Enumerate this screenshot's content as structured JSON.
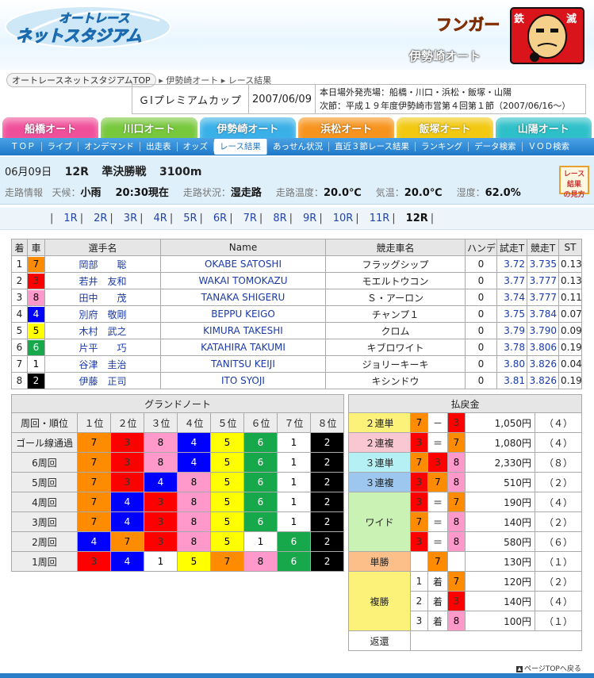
{
  "header": {
    "logo_line1": "オートレース",
    "logo_line2": "ネットスタジアム",
    "mascot_text": "フンガー",
    "mascot_badge": "鉄",
    "mascot_badge2": "滅",
    "site_sub": "伊勢崎オート"
  },
  "breadcrumb": {
    "home": "オートレースネットスタジアムTOP",
    "venue": "伊勢崎オート",
    "page": "レース結果"
  },
  "race_info": {
    "title": "ＧⅠプレミアムカップ",
    "date": "2007/06/09",
    "sales": "本日場外発売場：船橋・川口・浜松・飯塚・山陽",
    "next": "次節：平成１９年度伊勢崎市営第４回第１節（2007/06/16～）"
  },
  "venue_tabs": [
    {
      "label": "船橋オート",
      "color": "#f0509a"
    },
    {
      "label": "川口オート",
      "color": "#78c83c"
    },
    {
      "label": "伊勢崎オート",
      "color": "#3ab0e8"
    },
    {
      "label": "浜松オート",
      "color": "#f7941e"
    },
    {
      "label": "飯塚オート",
      "color": "#f2c811"
    },
    {
      "label": "山陽オート",
      "color": "#2ec0c8"
    }
  ],
  "subnav": [
    "ＴＯＰ",
    "ライブ",
    "オンデマンド",
    "出走表",
    "オッズ",
    "レース結果",
    "あっせん状況",
    "直近３節レース結果",
    "ランキング",
    "データ検索",
    "ＶＯＤ検索"
  ],
  "subnav_current": 5,
  "race_line": {
    "date": "06月09日",
    "race": "12R",
    "type": "準決勝戦",
    "distance": "3100m"
  },
  "conditions": {
    "road_info_label": "走路情報",
    "weather_label": "天候：",
    "weather": "小雨",
    "time": "20:30現在",
    "road_label": "走路状況：",
    "road": "湿走路",
    "road_temp_label": "走路温度：",
    "road_temp": "20.0℃",
    "air_label": "気温：",
    "air": "20.0℃",
    "humidity_label": "湿度：",
    "humidity": "62.0%"
  },
  "guide_button": {
    "line1": "レース結果",
    "line2": "の見方"
  },
  "race_numbers": [
    "1R",
    "2R",
    "3R",
    "4R",
    "5R",
    "6R",
    "7R",
    "8R",
    "9R",
    "10R",
    "11R",
    "12R"
  ],
  "race_current": "12R",
  "results": {
    "headers": [
      "着",
      "車",
      "選手名",
      "Name",
      "競走車名",
      "ハンデ",
      "試走T",
      "競走T",
      "ST"
    ],
    "rows": [
      {
        "pos": "1",
        "car": "7",
        "name": "岡部　　聡",
        "en": "OKABE SATOSHI",
        "machine": "フラッグシップ",
        "handi": "0",
        "trial": "3.72",
        "race": "3.735",
        "st": "0.13"
      },
      {
        "pos": "2",
        "car": "3",
        "name": "若井　友和",
        "en": "WAKAI TOMOKAZU",
        "machine": "モエルトウコン",
        "handi": "0",
        "trial": "3.77",
        "race": "3.777",
        "st": "0.13"
      },
      {
        "pos": "3",
        "car": "8",
        "name": "田中　　茂",
        "en": "TANAKA SHIGERU",
        "machine": "Ｓ・アーロン",
        "handi": "0",
        "trial": "3.74",
        "race": "3.777",
        "st": "0.11"
      },
      {
        "pos": "4",
        "car": "4",
        "name": "別府　敬剛",
        "en": "BEPPU KEIGO",
        "machine": "チャンプ１",
        "handi": "0",
        "trial": "3.75",
        "race": "3.784",
        "st": "0.07"
      },
      {
        "pos": "5",
        "car": "5",
        "name": "木村　武之",
        "en": "KIMURA TAKESHI",
        "machine": "クロム",
        "handi": "0",
        "trial": "3.79",
        "race": "3.790",
        "st": "0.09"
      },
      {
        "pos": "6",
        "car": "6",
        "name": "片平　　巧",
        "en": "KATAHIRA TAKUMI",
        "machine": "キブロワイト",
        "handi": "0",
        "trial": "3.78",
        "race": "3.806",
        "st": "0.19"
      },
      {
        "pos": "7",
        "car": "1",
        "name": "谷津　圭治",
        "en": "TANITSU KEIJI",
        "machine": "ジョリーキーキ",
        "handi": "0",
        "trial": "3.80",
        "race": "3.826",
        "st": "0.04"
      },
      {
        "pos": "8",
        "car": "2",
        "name": "伊藤　正司",
        "en": "ITO SYOJI",
        "machine": "キシンドウ",
        "handi": "0",
        "trial": "3.81",
        "race": "3.826",
        "st": "0.19"
      }
    ]
  },
  "car_colors": {
    "1": {
      "bg": "#ffffff",
      "fg": "#000000"
    },
    "2": {
      "bg": "#000000",
      "fg": "#ffffff"
    },
    "3": {
      "bg": "#ff0000",
      "fg": "#333333"
    },
    "4": {
      "bg": "#0000ff",
      "fg": "#ffffff"
    },
    "5": {
      "bg": "#ffff00",
      "fg": "#000000"
    },
    "6": {
      "bg": "#16a84a",
      "fg": "#ffffff"
    },
    "7": {
      "bg": "#ff8c00",
      "fg": "#000000"
    },
    "8": {
      "bg": "#ff99cc",
      "fg": "#000000"
    }
  },
  "grand_note": {
    "title": "グランドノート",
    "headers": [
      "周回・順位",
      "１位",
      "２位",
      "３位",
      "４位",
      "５位",
      "６位",
      "７位",
      "８位"
    ],
    "rows": [
      {
        "label": "ゴール線通過",
        "order": [
          "7",
          "3",
          "8",
          "4",
          "5",
          "6",
          "1",
          "2"
        ]
      },
      {
        "label": "6周回",
        "order": [
          "7",
          "3",
          "8",
          "4",
          "5",
          "6",
          "1",
          "2"
        ]
      },
      {
        "label": "5周回",
        "order": [
          "7",
          "3",
          "4",
          "8",
          "5",
          "6",
          "1",
          "2"
        ]
      },
      {
        "label": "4周回",
        "order": [
          "7",
          "4",
          "3",
          "8",
          "5",
          "6",
          "1",
          "2"
        ]
      },
      {
        "label": "3周回",
        "order": [
          "7",
          "4",
          "3",
          "8",
          "5",
          "6",
          "1",
          "2"
        ]
      },
      {
        "label": "2周回",
        "order": [
          "4",
          "7",
          "3",
          "8",
          "5",
          "1",
          "6",
          "2"
        ]
      },
      {
        "label": "1周回",
        "order": [
          "3",
          "4",
          "1",
          "5",
          "7",
          "8",
          "6",
          "2"
        ]
      }
    ]
  },
  "payout": {
    "title": "払戻金",
    "ren2tan": {
      "label": "２連単",
      "a": "7",
      "sep": "－",
      "b": "3",
      "amount": "1,050円",
      "pop": "（４）"
    },
    "ren2fuku": {
      "label": "２連複",
      "a": "3",
      "sep": "＝",
      "b": "7",
      "amount": "1,080円",
      "pop": "（４）"
    },
    "ren3tan": {
      "label": "３連単",
      "a": "7",
      "b": "3",
      "c": "8",
      "amount": "2,330円",
      "pop": "（８）"
    },
    "ren3fuku": {
      "label": "３連複",
      "a": "3",
      "b": "7",
      "c": "8",
      "amount": "510円",
      "pop": "（２）"
    },
    "wide": {
      "label": "ワイド",
      "rows": [
        {
          "a": "3",
          "sep": "＝",
          "b": "7",
          "amount": "190円",
          "pop": "（４）"
        },
        {
          "a": "7",
          "sep": "＝",
          "b": "8",
          "amount": "140円",
          "pop": "（２）"
        },
        {
          "a": "3",
          "sep": "＝",
          "b": "8",
          "amount": "580円",
          "pop": "（６）"
        }
      ]
    },
    "tansho": {
      "label": "単勝",
      "a": "7",
      "amount": "130円",
      "pop": "（１）"
    },
    "fukusho": {
      "label": "複勝",
      "rows": [
        {
          "rank": "1",
          "chaku": "着",
          "car": "7",
          "amount": "120円",
          "pop": "（２）"
        },
        {
          "rank": "2",
          "chaku": "着",
          "car": "3",
          "amount": "140円",
          "pop": "（４）"
        },
        {
          "rank": "3",
          "chaku": "着",
          "car": "8",
          "amount": "100円",
          "pop": "（１）"
        }
      ]
    },
    "henkan": {
      "label": "返還"
    },
    "label_colors": {
      "ren2tan": "#fcf27a",
      "ren2fuku": "#f9c7d2",
      "ren3tan": "#b5f0f5",
      "ren3fuku": "#9dc7ef",
      "wide": "#c9f2b4",
      "tansho": "#fdbf8a",
      "fukusho": "#fcf27a",
      "henkan": "#ffffff"
    }
  },
  "footer": {
    "page_top": "ページTOPへ戻る",
    "arrow": "▲"
  }
}
